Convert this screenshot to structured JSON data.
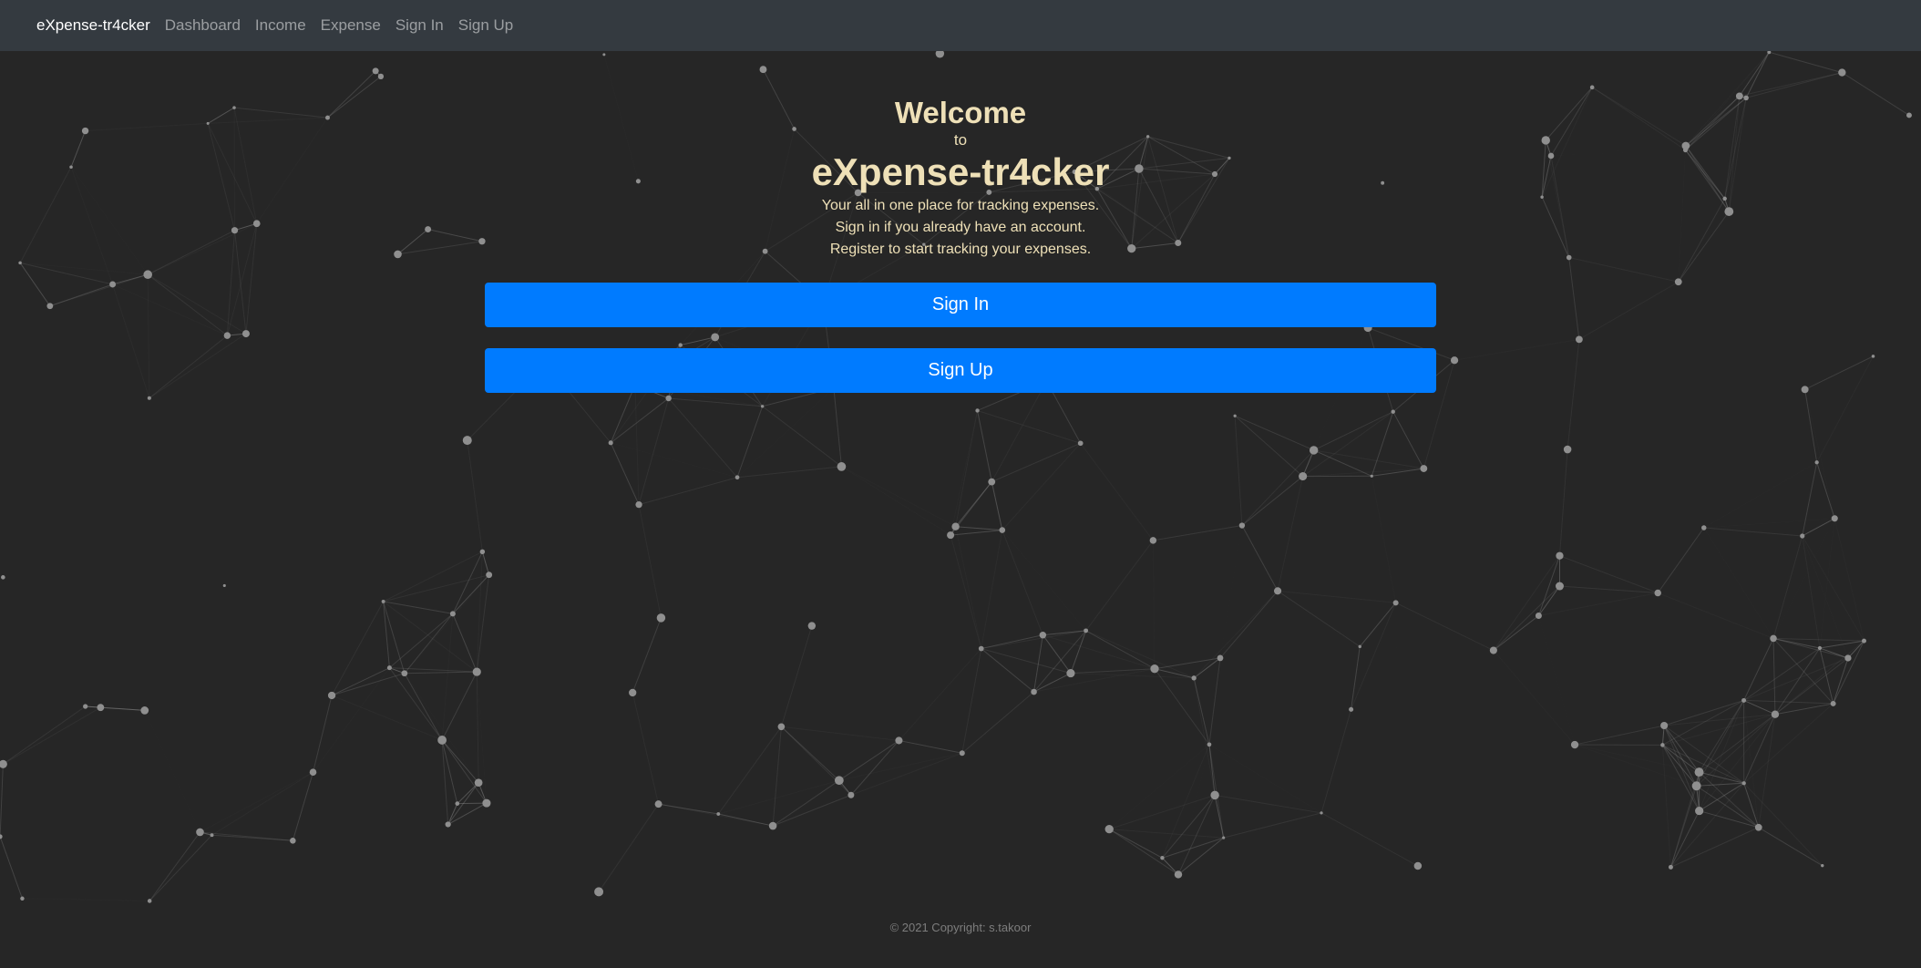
{
  "navbar": {
    "brand": "eXpense-tr4cker",
    "links": [
      "Dashboard",
      "Income",
      "Expense",
      "Sign In",
      "Sign Up"
    ]
  },
  "hero": {
    "welcome": "Welcome",
    "to": "to",
    "app_title": "eXpense-tr4cker",
    "lines": [
      "Your all in one place for tracking expenses.",
      "Sign in if you already have an account.",
      "Register to start tracking your expenses."
    ]
  },
  "buttons": {
    "sign_in": "Sign In",
    "sign_up": "Sign Up"
  },
  "footer": {
    "copyright": "© 2021 Copyright: s.takoor"
  },
  "colors": {
    "background": "#262626",
    "navbar": "#343a40",
    "accent": "#007bff",
    "title_text": "#eee0b7"
  }
}
